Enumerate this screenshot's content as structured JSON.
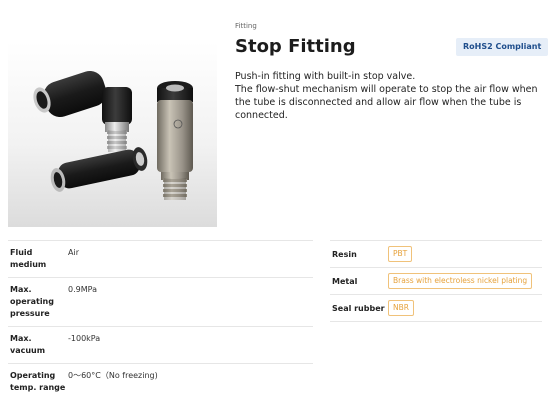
{
  "category": "Fitting",
  "title": "Stop Fitting",
  "badge": "RoHS2 Compliant",
  "description": [
    "Push-in fitting with built-in stop valve.",
    "The flow-shut mechanism will operate to stop the air flow when the tube is disconnected and allow air flow when the tube is connected."
  ],
  "specs": [
    {
      "label": "Fluid medium",
      "value": "Air"
    },
    {
      "label": "Max. operating pressure",
      "value": "0.9MPa"
    },
    {
      "label": "Max. vacuum",
      "value": "-100kPa"
    },
    {
      "label": "Operating temp. range",
      "value": "0〜60°C（No freezing)"
    }
  ],
  "materials": [
    {
      "label": "Resin",
      "value": "PBT"
    },
    {
      "label": "Metal",
      "value": "Brass with electroless nickel plating"
    },
    {
      "label": "Seal rubber",
      "value": "NBR"
    }
  ],
  "colors": {
    "badge_bg": "#e6eef8",
    "badge_text": "#1f4e8c",
    "material_tag": "#e6a23c"
  }
}
